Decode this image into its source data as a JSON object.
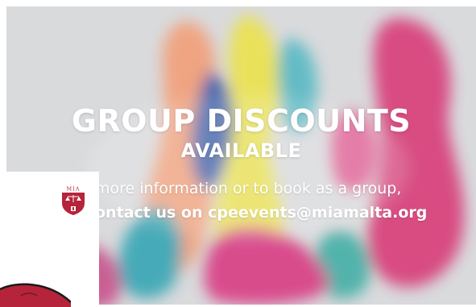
{
  "banner": {
    "headline_line1": "GROUP DISCOUNTS",
    "headline_line2": "AVAILABLE",
    "info_text": "more information or to book as a group,",
    "contact_prefix": "ontact us on",
    "contact_email": "cpeevents@miamalta.org"
  },
  "logo": {
    "crest_text": "MIA",
    "icon": "mia-crest-icon"
  },
  "colors": {
    "crest_red": "#b5243a",
    "ink_pink": "#d8407a",
    "ink_yellow": "#e8e04a",
    "ink_orange": "#f2a07a",
    "ink_teal": "#3aa7b5",
    "ink_blue": "#3b5fa8"
  }
}
